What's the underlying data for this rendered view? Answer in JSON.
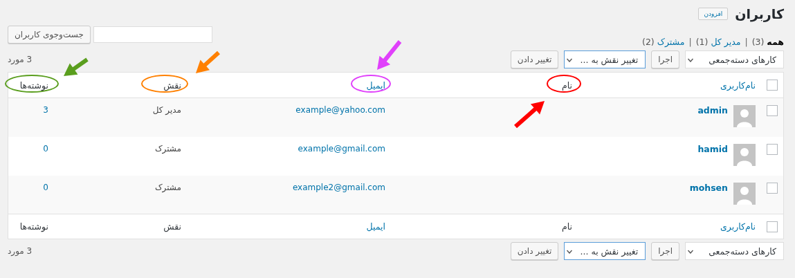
{
  "page": {
    "title": "کاربران",
    "add_button": "افزودن"
  },
  "filters": {
    "separator": "|",
    "items": [
      {
        "label": "همه",
        "count": "(3)",
        "selected": true
      },
      {
        "label": "مدیر کل",
        "count": "(1)",
        "selected": false
      },
      {
        "label": "مشترک",
        "count": "(2)",
        "selected": false
      }
    ]
  },
  "search": {
    "button": "جست‌وجوی کاربران"
  },
  "tablenav_top": {
    "bulk_select": "کارهای دسته‌جمعی",
    "apply": "اجرا",
    "role_select": "تغییر نقش به ...",
    "change": "تغییر دادن",
    "count": "3 مورد"
  },
  "table": {
    "header_checked": false,
    "footer_checked": false,
    "columns": [
      {
        "label": "نام‌کاربری",
        "kind": "link"
      },
      {
        "label": "نام",
        "kind": "plain",
        "color": "#ff0000"
      },
      {
        "label": "ایمیل",
        "kind": "link",
        "color": "#e040fb"
      },
      {
        "label": "نقش",
        "kind": "plain",
        "color": "#ff8000"
      },
      {
        "label": "نوشته‌ها",
        "kind": "plain",
        "color": "#5a9e1e"
      }
    ],
    "footer_columns": [
      {
        "label": "نام‌کاربری",
        "kind": "link"
      },
      {
        "label": "نام",
        "kind": "plain"
      },
      {
        "label": "ایمیل",
        "kind": "link"
      },
      {
        "label": "نقش",
        "kind": "plain"
      },
      {
        "label": "نوشته‌ها",
        "kind": "plain"
      }
    ],
    "rows": [
      {
        "checked": false,
        "username": "admin",
        "email": "example@yahoo.com",
        "role": "مدیر کل",
        "posts": "3"
      },
      {
        "checked": false,
        "username": "hamid",
        "email": "example@gmail.com",
        "role": "مشترک",
        "posts": "0"
      },
      {
        "checked": false,
        "username": "mohsen",
        "email": "example2@gmail.com",
        "role": "مشترک",
        "posts": "0"
      }
    ]
  },
  "tablenav_bottom": {
    "bulk_select": "کارهای دسته‌جمعی",
    "apply": "اجرا",
    "role_select": "تغییر نقش به ...",
    "change": "تغییر دادن",
    "count": "3 مورد"
  }
}
